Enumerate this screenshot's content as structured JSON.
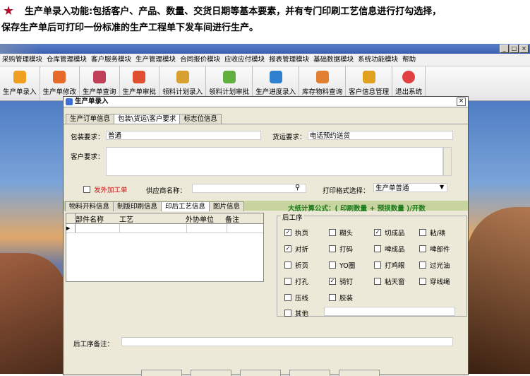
{
  "caption": {
    "line1": "生产单录入功能:包括客户、产品、数量、交货日期等基本要素，并有专门印刷工艺信息进行打勾选择，",
    "line2": "保存生产单后可打印一份标准的生产工程单下发车间进行生产。"
  },
  "window": {
    "min": "_",
    "max": "□",
    "close": "×"
  },
  "menu": [
    "采购管理模块",
    "仓库管理模块",
    "客户服务模块",
    "生产管理模块",
    "合同报价模块",
    "应收应付模块",
    "报表管理模块",
    "基础数据模块",
    "系统功能模块",
    "帮助"
  ],
  "toolbar": [
    {
      "label": "生产单录入",
      "color": "#f0a020"
    },
    {
      "label": "生产单修改",
      "color": "#e86a2a"
    },
    {
      "label": "生产单查询",
      "color": "#c0405a"
    },
    {
      "label": "生产单审批",
      "color": "#e05030"
    },
    {
      "label": "领料计划录入",
      "color": "#d8a030"
    },
    {
      "label": "领料计划审批",
      "color": "#60b040"
    },
    {
      "label": "生产进度录入",
      "color": "#3080d0"
    },
    {
      "label": "库存物料查询",
      "color": "#e08030"
    },
    {
      "label": "客户信息管理",
      "color": "#e0a020"
    },
    {
      "label": "退出系统",
      "color": "#e04040"
    }
  ],
  "dialog": {
    "title": "生产单录入",
    "close": "×",
    "tabs": [
      "生产订单信息",
      "包装\\货运\\客户要求",
      "标志位信息"
    ],
    "packaging_label": "包装要求：",
    "packaging_value": "普通",
    "shipping_label": "货运要求：",
    "shipping_value": "电话预约送货",
    "customer_req_label": "客户要求：",
    "outsource_label": "发外加工单",
    "supplier_label": "供应商名称：",
    "print_format_label": "打印格式选择：",
    "print_format_value": "生产单普通",
    "subtabs": [
      "物料开料信息",
      "制版印刷信息",
      "印后工艺信息",
      "图片信息"
    ],
    "formula": "大纸计算公式：( 印刷数量 + 预损数量 )/开数",
    "grid_headers": [
      "部件名称",
      "工艺",
      "外协单位",
      "备注"
    ],
    "post_group_title": "后工序",
    "post_options": [
      {
        "label": "执页",
        "checked": true
      },
      {
        "label": "糊头",
        "checked": false
      },
      {
        "label": "切成品",
        "checked": true
      },
      {
        "label": "粘/裱",
        "checked": false
      },
      {
        "label": "对折",
        "checked": true
      },
      {
        "label": "打码",
        "checked": false
      },
      {
        "label": "啤成品",
        "checked": false
      },
      {
        "label": "啤部件",
        "checked": false
      },
      {
        "label": "折页",
        "checked": false
      },
      {
        "label": "YO圈",
        "checked": false
      },
      {
        "label": "打鸡眼",
        "checked": false
      },
      {
        "label": "过光油",
        "checked": false
      },
      {
        "label": "打孔",
        "checked": false
      },
      {
        "label": "骑钉",
        "checked": true
      },
      {
        "label": "粘天窗",
        "checked": false
      },
      {
        "label": "穿线绳",
        "checked": false
      },
      {
        "label": "压线",
        "checked": false
      },
      {
        "label": "胶装",
        "checked": false
      },
      {
        "label": "其他",
        "checked": false
      }
    ],
    "post_remark_label": "后工序备注："
  },
  "colors": {
    "accent": "#3a5fb0",
    "star": "#b0102a",
    "formula": "#1a7a1a",
    "outsource": "#d01010"
  }
}
